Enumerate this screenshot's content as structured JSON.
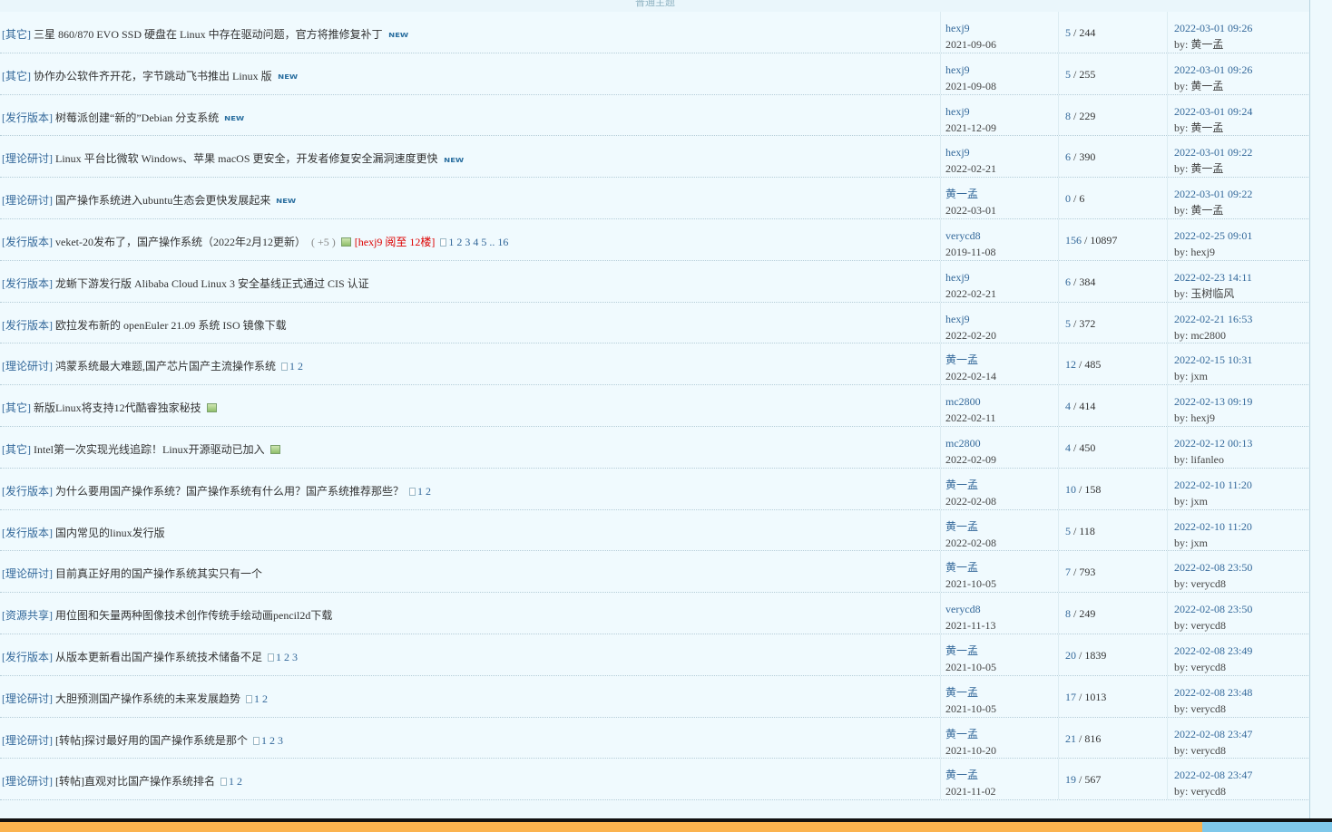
{
  "section_header": "普通主题",
  "threads": [
    {
      "category": "[其它]",
      "title": "三星 860/870 EVO SSD 硬盘在 Linux 中存在驱动问题，官方将推修复补丁",
      "new_badge": "NEW",
      "author": "hexj9",
      "posted": "2021-09-06",
      "replies": "5",
      "views": "244",
      "last_time": "2022-03-01 09:26",
      "last_by": "by: 黄一孟"
    },
    {
      "category": "[其它]",
      "title": "协作办公软件齐开花，字节跳动飞书推出 Linux 版",
      "new_badge": "NEW",
      "author": "hexj9",
      "posted": "2021-09-08",
      "replies": "5",
      "views": "255",
      "last_time": "2022-03-01 09:26",
      "last_by": "by: 黄一孟"
    },
    {
      "category": "[发行版本]",
      "title": "树莓派创建“新的”Debian 分支系统",
      "new_badge": "NEW",
      "author": "hexj9",
      "posted": "2021-12-09",
      "replies": "8",
      "views": "229",
      "last_time": "2022-03-01 09:24",
      "last_by": "by: 黄一孟"
    },
    {
      "category": "[理论研讨]",
      "title": "Linux 平台比微软 Windows、苹果 macOS 更安全，开发者修复安全漏洞速度更快",
      "new_badge": "NEW",
      "author": "hexj9",
      "posted": "2022-02-21",
      "replies": "6",
      "views": "390",
      "last_time": "2022-03-01 09:22",
      "last_by": "by: 黄一孟"
    },
    {
      "category": "[理论研讨]",
      "title": "国产操作系统进入ubuntu生态会更快发展起来",
      "new_badge": "NEW",
      "author": "黄一孟",
      "posted": "2022-03-01",
      "replies": "0",
      "views": "6",
      "last_time": "2022-03-01 09:22",
      "last_by": "by: 黄一孟"
    },
    {
      "category": "[发行版本]",
      "title": "veket-20发布了，国产操作系统（2022年2月12更新）",
      "plus": "( +5 )",
      "image": true,
      "highlight": "[hexj9 阅至 12楼]",
      "pages": [
        "1",
        "2",
        "3",
        "4",
        "5",
        ".. 16"
      ],
      "author": "verycd8",
      "posted": "2019-11-08",
      "replies": "156",
      "views": "10897",
      "last_time": "2022-02-25 09:01",
      "last_by": "by: hexj9"
    },
    {
      "category": "[发行版本]",
      "title": "龙蜥下游发行版 Alibaba Cloud Linux 3 安全基线正式通过 CIS 认证",
      "author": "hexj9",
      "posted": "2022-02-21",
      "replies": "6",
      "views": "384",
      "last_time": "2022-02-23 14:11",
      "last_by": "by: 玉树临风"
    },
    {
      "category": "[发行版本]",
      "title": "欧拉发布新的 openEuler 21.09 系统 ISO 镜像下载",
      "author": "hexj9",
      "posted": "2022-02-20",
      "replies": "5",
      "views": "372",
      "last_time": "2022-02-21 16:53",
      "last_by": "by: mc2800"
    },
    {
      "category": "[理论研讨]",
      "title": "鸿蒙系统最大难题,国产芯片国产主流操作系统",
      "pages": [
        "1",
        "2"
      ],
      "author": "黄一孟",
      "posted": "2022-02-14",
      "replies": "12",
      "views": "485",
      "last_time": "2022-02-15 10:31",
      "last_by": "by: jxm"
    },
    {
      "category": "[其它]",
      "title": "新版Linux将支持12代酷睿独家秘技",
      "image": true,
      "author": "mc2800",
      "posted": "2022-02-11",
      "replies": "4",
      "views": "414",
      "last_time": "2022-02-13 09:19",
      "last_by": "by: hexj9"
    },
    {
      "category": "[其它]",
      "title": "Intel第一次实现光线追踪！Linux开源驱动已加入",
      "image": true,
      "author": "mc2800",
      "posted": "2022-02-09",
      "replies": "4",
      "views": "450",
      "last_time": "2022-02-12 00:13",
      "last_by": "by: lifanleo"
    },
    {
      "category": "[发行版本]",
      "title": "为什么要用国产操作系统？国产操作系统有什么用？国产系统推荐那些？",
      "pages": [
        "1",
        "2"
      ],
      "author": "黄一孟",
      "posted": "2022-02-08",
      "replies": "10",
      "views": "158",
      "last_time": "2022-02-10 11:20",
      "last_by": "by: jxm"
    },
    {
      "category": "[发行版本]",
      "title": "国内常见的linux发行版",
      "author": "黄一孟",
      "posted": "2022-02-08",
      "replies": "5",
      "views": "118",
      "last_time": "2022-02-10 11:20",
      "last_by": "by: jxm"
    },
    {
      "category": "[理论研讨]",
      "title": "目前真正好用的国产操作系统其实只有一个",
      "author": "黄一孟",
      "posted": "2021-10-05",
      "replies": "7",
      "views": "793",
      "last_time": "2022-02-08 23:50",
      "last_by": "by: verycd8"
    },
    {
      "category": "[资源共享]",
      "title": "用位图和矢量两种图像技术创作传统手绘动画pencil2d下载",
      "author": "verycd8",
      "posted": "2021-11-13",
      "replies": "8",
      "views": "249",
      "last_time": "2022-02-08 23:50",
      "last_by": "by: verycd8"
    },
    {
      "category": "[发行版本]",
      "title": "从版本更新看出国产操作系统技术储备不足",
      "pages": [
        "1",
        "2",
        "3"
      ],
      "author": "黄一孟",
      "posted": "2021-10-05",
      "replies": "20",
      "views": "1839",
      "last_time": "2022-02-08 23:49",
      "last_by": "by: verycd8"
    },
    {
      "category": "[理论研讨]",
      "title": "大胆预测国产操作系统的未来发展趋势",
      "pages": [
        "1",
        "2"
      ],
      "author": "黄一孟",
      "posted": "2021-10-05",
      "replies": "17",
      "views": "1013",
      "last_time": "2022-02-08 23:48",
      "last_by": "by: verycd8"
    },
    {
      "category": "[理论研讨]",
      "title": "[转帖]探讨最好用的国产操作系统是那个",
      "pages": [
        "1",
        "2",
        "3"
      ],
      "author": "黄一孟",
      "posted": "2021-10-20",
      "replies": "21",
      "views": "816",
      "last_time": "2022-02-08 23:47",
      "last_by": "by: verycd8"
    },
    {
      "category": "[理论研讨]",
      "title": "[转帖]直观对比国产操作系统排名",
      "pages": [
        "1",
        "2"
      ],
      "author": "黄一孟",
      "posted": "2021-11-02",
      "replies": "19",
      "views": "567",
      "last_time": "2022-02-08 23:47",
      "last_by": "by: verycd8"
    }
  ],
  "colors": {
    "link": "#33689a",
    "category": "#0b5c84",
    "highlight": "#dd0000",
    "footer": "#fbb34f",
    "footer_accent": "#7fc8ea"
  }
}
